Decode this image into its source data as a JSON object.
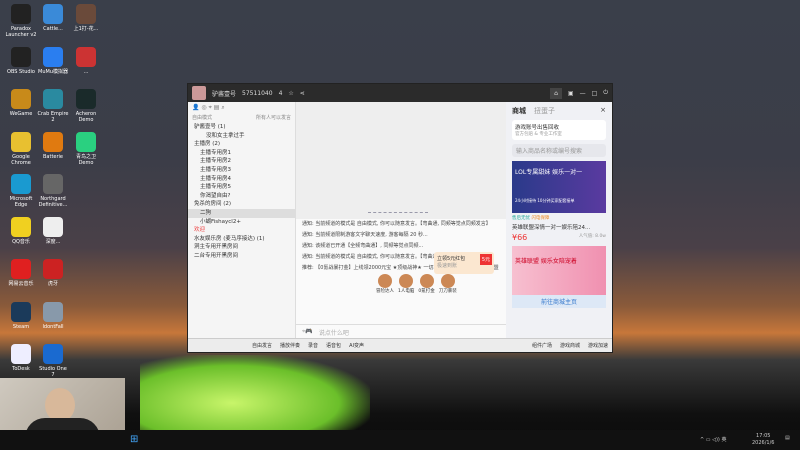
{
  "desktop": {
    "icons": [
      {
        "label": "Paradox Launcher v2",
        "color": "#222"
      },
      {
        "label": "Cattle...",
        "color": "#3a8ad8"
      },
      {
        "label": "上1打-花...",
        "color": "#6a4a3a"
      },
      {
        "label": "OBS Studio",
        "color": "#222"
      },
      {
        "label": "MuMu模拟器",
        "color": "#2a7ef0"
      },
      {
        "label": "...",
        "color": "#c33"
      },
      {
        "label": "WeGame",
        "color": "#c88a1a"
      },
      {
        "label": "Crab Empire 2",
        "color": "#2a8aa0"
      },
      {
        "label": "Acheron Demo",
        "color": "#1a2a2a"
      },
      {
        "label": "Google Chrome",
        "color": "#e8c030"
      },
      {
        "label": "Batterie",
        "color": "#e07a10"
      },
      {
        "label": "青鸟之卫 Demo",
        "color": "#2ad080"
      },
      {
        "label": "Microsoft Edge",
        "color": "#1a9ad0"
      },
      {
        "label": "Northgard Definitive...",
        "color": "#666"
      },
      {
        "label": "QQ音乐",
        "color": "#f0d020"
      },
      {
        "label": "深度...",
        "color": "#eee"
      },
      {
        "label": "网易云音乐",
        "color": "#e02020"
      },
      {
        "label": "虎牙",
        "color": "#c22"
      },
      {
        "label": "Steam",
        "color": "#1b3a5a"
      },
      {
        "label": "IdontFall",
        "color": "#8899aa"
      },
      {
        "label": "ToDesk",
        "color": "#eef"
      },
      {
        "label": "Studio One 7",
        "color": "#1a6ad0"
      }
    ]
  },
  "window": {
    "title": "驴酱壹号",
    "room_id": "57511040",
    "users": "4",
    "mode": "自由模式",
    "mode_note": "所有人可以发言",
    "tree": [
      "驴酱壹号 (1)",
      "没和女主拿过手",
      "主播房 (2)",
      "主播专用房1",
      "主播专用房2",
      "主播专用房3",
      "主播专用房4",
      "主播专用房5",
      "你渴望自由?",
      "免杀的房间 (2)",
      "二狗",
      "小蝴Fishaycl2+",
      "欢迎",
      "水友娱乐房 (麦马序接达) (1)",
      "洞主专用开黑房间",
      "二台专用开黑房间"
    ],
    "messages": [
      "通知: 当前频道的模式是 自由模式, 你可以随意发言。【弯曲通, 同频等觉点同频发言】",
      "通知: 当前频道限制游客文字聊天速度, 游客每隔 20 秒...",
      "通知: 该频道已开通【全频弯曲通】, 同频等觉点同频...",
      "通知: 当前频道的模式是 自由模式, 你可以随意发言。【弯曲通, 同频等觉点同频发言】",
      "推荐: 【0氪战暴打金】上线领2000元宝 ★顶级战神★ 一切靠打 ★ 内置挂机 ★ 保护同盟"
    ],
    "games": [
      "冒险达人",
      "1人电脑",
      "0氪打金",
      "刀刀暴装"
    ],
    "promo": {
      "title": "立领5元红包",
      "sub": "极速到账",
      "badge": "5元"
    },
    "input_placeholder": "说点什么吧",
    "bottom": [
      "自由发言",
      "播放伴奏",
      "录音",
      "语音包",
      "AI变声",
      "组件广场",
      "游戏商城",
      "游戏加速"
    ],
    "shop": {
      "tabs": [
        "商城",
        "扭蛋子"
      ],
      "banner_title": "游戏账号出售回收",
      "banner_sub": "官方包赔 & 专业工作室",
      "search": "输入商品名称或编号搜索",
      "card1": {
        "img_title": "LOL专属甜妹 娱乐一对一",
        "img_sub": "24小时接待 10分钟买家配套接单",
        "tags": [
          "售后无忧",
          "闪电保障"
        ],
        "name": "英雄联盟深情一对一娱乐陪24...",
        "price": "¥66",
        "pop": "人气值: 8.0w"
      },
      "card2": {
        "img_title": "英雄联盟 娱乐女陪宠着",
        "button": "前往商城主页"
      }
    }
  },
  "taskbar": {
    "time": "17:05",
    "date": "2026/1/6",
    "ime": "英"
  }
}
